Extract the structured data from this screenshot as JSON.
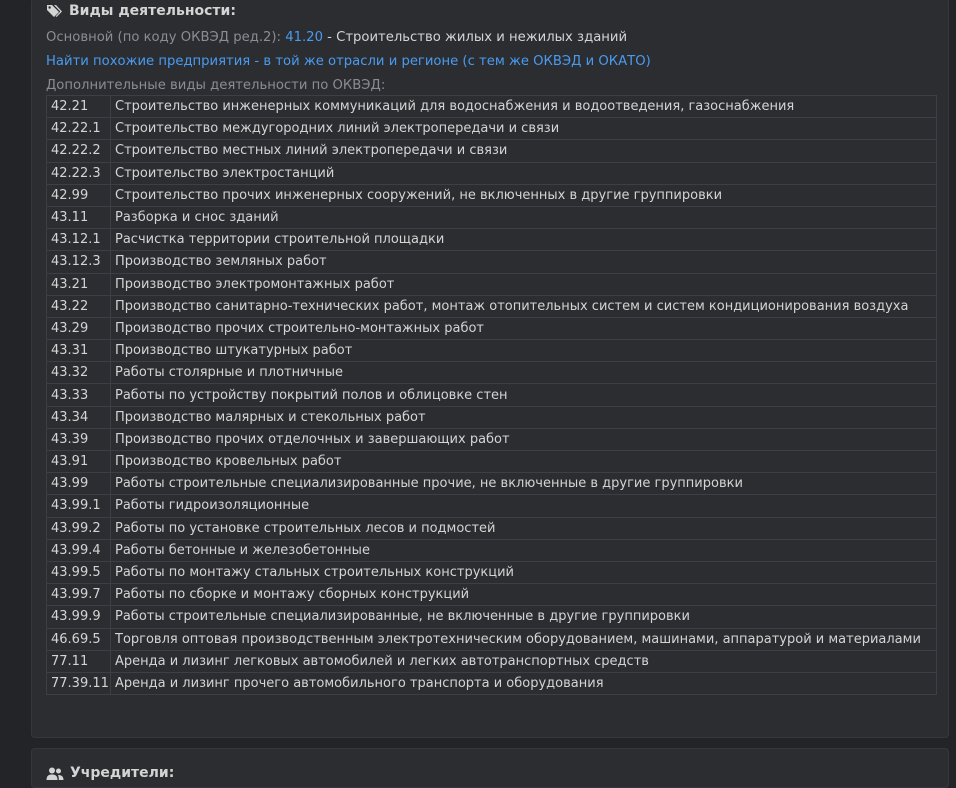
{
  "activities": {
    "title": "Виды деятельности:",
    "main_prefix": "Основной (по коду ОКВЭД ред.2):",
    "main_code": "41.20",
    "main_desc": "- Строительство жилых и нежилых зданий",
    "similar_link": "Найти похожие предприятия - в той же отрасли и регионе (с тем же ОКВЭД и ОКАТО)",
    "extra_label": "Дополнительные виды деятельности по ОКВЭД:",
    "rows": [
      {
        "code": "42.21",
        "name": "Строительство инженерных коммуникаций для водоснабжения и водоотведения, газоснабжения"
      },
      {
        "code": "42.22.1",
        "name": "Строительство междугородних линий электропередачи и связи"
      },
      {
        "code": "42.22.2",
        "name": "Строительство местных линий электропередачи и связи"
      },
      {
        "code": "42.22.3",
        "name": "Строительство электростанций"
      },
      {
        "code": "42.99",
        "name": "Строительство прочих инженерных сооружений, не включенных в другие группировки"
      },
      {
        "code": "43.11",
        "name": "Разборка и снос зданий"
      },
      {
        "code": "43.12.1",
        "name": "Расчистка территории строительной площадки"
      },
      {
        "code": "43.12.3",
        "name": "Производство земляных работ"
      },
      {
        "code": "43.21",
        "name": "Производство электромонтажных работ"
      },
      {
        "code": "43.22",
        "name": "Производство санитарно-технических работ, монтаж отопительных систем и систем кондиционирования воздуха"
      },
      {
        "code": "43.29",
        "name": "Производство прочих строительно-монтажных работ"
      },
      {
        "code": "43.31",
        "name": "Производство штукатурных работ"
      },
      {
        "code": "43.32",
        "name": "Работы столярные и плотничные"
      },
      {
        "code": "43.33",
        "name": "Работы по устройству покрытий полов и облицовке стен"
      },
      {
        "code": "43.34",
        "name": "Производство малярных и стекольных работ"
      },
      {
        "code": "43.39",
        "name": "Производство прочих отделочных и завершающих работ"
      },
      {
        "code": "43.91",
        "name": "Производство кровельных работ"
      },
      {
        "code": "43.99",
        "name": "Работы строительные специализированные прочие, не включенные в другие группировки"
      },
      {
        "code": "43.99.1",
        "name": "Работы гидроизоляционные"
      },
      {
        "code": "43.99.2",
        "name": "Работы по установке строительных лесов и подмостей"
      },
      {
        "code": "43.99.4",
        "name": "Работы бетонные и железобетонные"
      },
      {
        "code": "43.99.5",
        "name": "Работы по монтажу стальных строительных конструкций"
      },
      {
        "code": "43.99.7",
        "name": "Работы по сборке и монтажу сборных конструкций"
      },
      {
        "code": "43.99.9",
        "name": "Работы строительные специализированные, не включенные в другие группировки"
      },
      {
        "code": "46.69.5",
        "name": "Торговля оптовая производственным электротехническим оборудованием, машинами, аппаратурой и материалами"
      },
      {
        "code": "77.11",
        "name": "Аренда и лизинг легковых автомобилей и легких автотранспортных средств"
      },
      {
        "code": "77.39.11",
        "name": "Аренда и лизинг прочего автомобильного транспорта и оборудования"
      }
    ]
  },
  "founders": {
    "title": "Учредители:"
  },
  "icons": {
    "activities": "tags-icon",
    "founders": "users-icon"
  },
  "colors": {
    "background": "#222428",
    "card": "#2b2d31",
    "link": "#4a9bf0",
    "muted": "#8a8d92",
    "text": "#d4d4d4"
  }
}
